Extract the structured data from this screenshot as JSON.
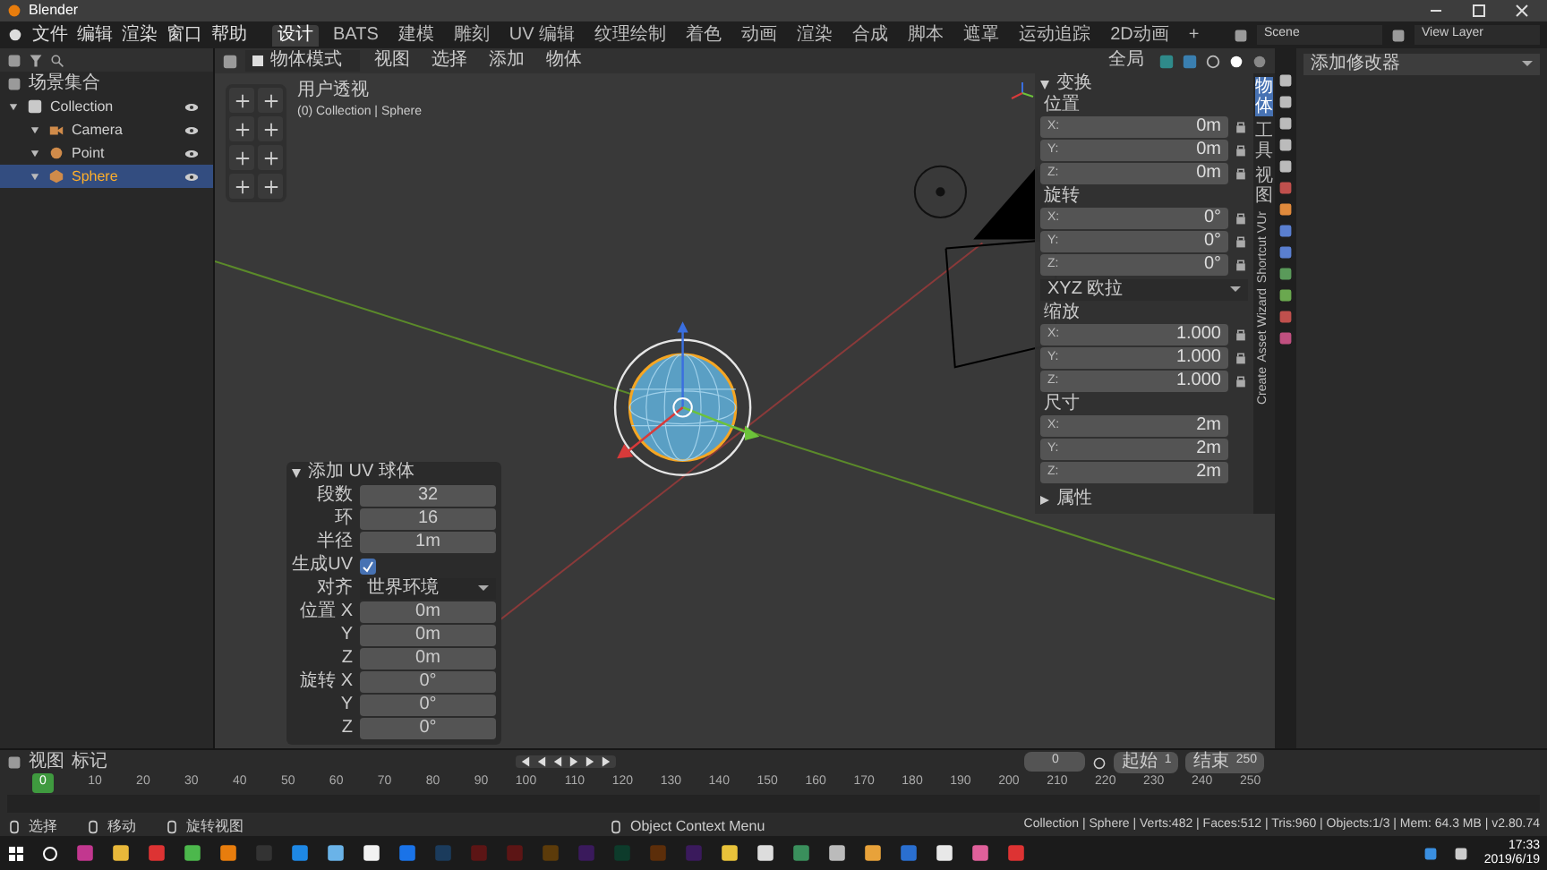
{
  "window": {
    "title": "Blender"
  },
  "menu": [
    "文件",
    "编辑",
    "渲染",
    "窗口",
    "帮助"
  ],
  "workspaces": [
    {
      "label": "设计",
      "selected": true
    },
    {
      "label": "BATS",
      "selected": false
    },
    {
      "label": "建模",
      "selected": false
    },
    {
      "label": "雕刻",
      "selected": false
    },
    {
      "label": "UV 编辑",
      "selected": false
    },
    {
      "label": "纹理绘制",
      "selected": false
    },
    {
      "label": "着色",
      "selected": false
    },
    {
      "label": "动画",
      "selected": false
    },
    {
      "label": "渲染",
      "selected": false
    },
    {
      "label": "合成",
      "selected": false
    },
    {
      "label": "脚本",
      "selected": false
    },
    {
      "label": "遮罩",
      "selected": false
    },
    {
      "label": "运动追踪",
      "selected": false
    },
    {
      "label": "2D动画",
      "selected": false
    },
    {
      "label": "+",
      "selected": false
    }
  ],
  "scene": {
    "scene": "Scene",
    "view_layer": "View Layer"
  },
  "outliner": {
    "root": "场景集合",
    "items": [
      {
        "label": "Collection",
        "kind": "collection",
        "selected": false,
        "children": [
          {
            "label": "Camera",
            "kind": "camera",
            "selected": false
          },
          {
            "label": "Point",
            "kind": "light",
            "selected": false
          },
          {
            "label": "Sphere",
            "kind": "mesh",
            "selected": true
          }
        ]
      }
    ]
  },
  "viewport": {
    "mode": "物体模式",
    "menus": [
      "视图",
      "选择",
      "添加",
      "物体"
    ],
    "view_name": "用户透视",
    "context": "(0) Collection | Sphere",
    "transform_orientation": "全局"
  },
  "sidebar": {
    "tabs": [
      {
        "label": "物体",
        "selected": true
      },
      {
        "label": "工具",
        "selected": false
      },
      {
        "label": "视图",
        "selected": false
      },
      {
        "label": "Shortcut VUr",
        "selected": false
      },
      {
        "label": "Asset Wizard",
        "selected": false
      },
      {
        "label": "Create",
        "selected": false
      }
    ],
    "transform_title": "变换",
    "groups": [
      {
        "label": "位置",
        "locks": true,
        "fields": [
          {
            "axis": "X:",
            "value": "0m"
          },
          {
            "axis": "Y:",
            "value": "0m"
          },
          {
            "axis": "Z:",
            "value": "0m"
          }
        ]
      },
      {
        "label": "旋转",
        "locks": true,
        "fields": [
          {
            "axis": "X:",
            "value": "0°"
          },
          {
            "axis": "Y:",
            "value": "0°"
          },
          {
            "axis": "Z:",
            "value": "0°"
          }
        ]
      },
      {
        "label": "XYZ 欧拉",
        "kind": "dropdown"
      },
      {
        "label": "缩放",
        "locks": true,
        "fields": [
          {
            "axis": "X:",
            "value": "1.000"
          },
          {
            "axis": "Y:",
            "value": "1.000"
          },
          {
            "axis": "Z:",
            "value": "1.000"
          }
        ]
      },
      {
        "label": "尺寸",
        "locks": false,
        "fields": [
          {
            "axis": "X:",
            "value": "2m"
          },
          {
            "axis": "Y:",
            "value": "2m"
          },
          {
            "axis": "Z:",
            "value": "2m"
          }
        ]
      }
    ],
    "properties_title": "属性"
  },
  "operator": {
    "title": "添加 UV 球体",
    "rows": [
      {
        "kind": "field",
        "label": "段数",
        "value": "32"
      },
      {
        "kind": "field",
        "label": "环",
        "value": "16"
      },
      {
        "kind": "field",
        "label": "半径",
        "value": "1m"
      },
      {
        "kind": "checkbox",
        "label": "生成UV",
        "checked": true
      },
      {
        "kind": "dropdown",
        "label": "对齐",
        "value": "世界环境"
      },
      {
        "kind": "field",
        "label": "位置 X",
        "value": "0m"
      },
      {
        "kind": "field",
        "label": "Y",
        "value": "0m"
      },
      {
        "kind": "field",
        "label": "Z",
        "value": "0m"
      },
      {
        "kind": "field",
        "label": "旋转 X",
        "value": "0°"
      },
      {
        "kind": "field",
        "label": "Y",
        "value": "0°"
      },
      {
        "kind": "field",
        "label": "Z",
        "value": "0°"
      }
    ]
  },
  "properties": {
    "button": "添加修改器"
  },
  "timeline": {
    "menus": [
      "视图",
      "标记"
    ],
    "current_frame": "0",
    "start_label": "起始",
    "start": "1",
    "end_label": "结束",
    "end": "250",
    "playhead": "0",
    "ticks": [
      "10",
      "20",
      "30",
      "40",
      "50",
      "60",
      "70",
      "80",
      "90",
      "100",
      "110",
      "120",
      "130",
      "140",
      "150",
      "160",
      "170",
      "180",
      "190",
      "200",
      "210",
      "220",
      "230",
      "240",
      "250"
    ]
  },
  "status_bar": {
    "hints": [
      "选择",
      "移动",
      "旋转视图",
      "Object Context Menu"
    ],
    "stats": "Collection | Sphere | Verts:482 | Faces:512 | Tris:960 | Objects:1/3 | Mem: 64.3 MB | v2.80.74"
  },
  "taskbar": {
    "time": "17:33",
    "date": "2019/6/19"
  }
}
